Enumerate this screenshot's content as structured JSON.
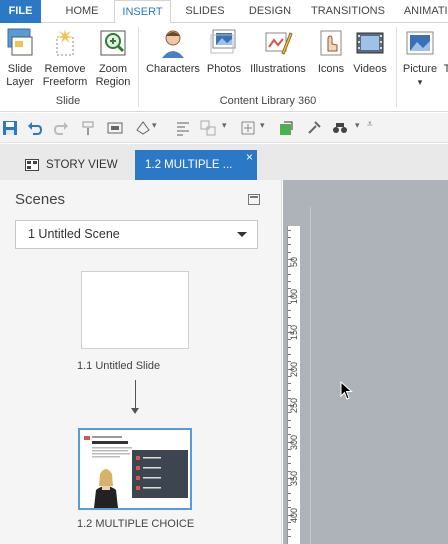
{
  "ribbon_tabs": [
    "FILE",
    "HOME",
    "INSERT",
    "SLIDES",
    "DESIGN",
    "TRANSITIONS",
    "ANIMATIO"
  ],
  "ribbon": {
    "slide_group": {
      "buttons": [
        {
          "line1": "Slide",
          "line2": "Layer",
          "icon": "slide-layer-icon"
        },
        {
          "line1": "Remove",
          "line2": "Freeform",
          "icon": "remove-freeform-icon"
        },
        {
          "line1": "Zoom",
          "line2": "Region",
          "icon": "zoom-region-icon"
        }
      ],
      "label": "Slide"
    },
    "content_library_group": {
      "buttons": [
        {
          "label": "Characters",
          "icon": "characters-icon"
        },
        {
          "label": "Photos",
          "icon": "photos-icon"
        },
        {
          "label": "Illustrations",
          "icon": "illustrations-icon"
        },
        {
          "label": "Icons",
          "icon": "icons-icon"
        },
        {
          "label": "Videos",
          "icon": "videos-icon"
        }
      ],
      "label": "Content Library 360"
    },
    "picture_button": {
      "label": "Picture",
      "extra": "T"
    }
  },
  "story_tabs": {
    "story_view": "STORY VIEW",
    "active_slide": "1.2 MULTIPLE ...",
    "close": "×"
  },
  "scenes": {
    "title": "Scenes",
    "selected_scene": "1 Untitled Scene",
    "slides": [
      {
        "label": "1.1 Untitled Slide"
      },
      {
        "label": "1.2 MULTIPLE CHOICE"
      }
    ]
  },
  "ruler": {
    "labels": [
      "50",
      "100",
      "150",
      "200",
      "250",
      "300",
      "350",
      "400"
    ]
  },
  "colors": {
    "accent": "#2b78c6",
    "selection_border": "#5b9bd5",
    "canvas": "#aeb3b9"
  }
}
